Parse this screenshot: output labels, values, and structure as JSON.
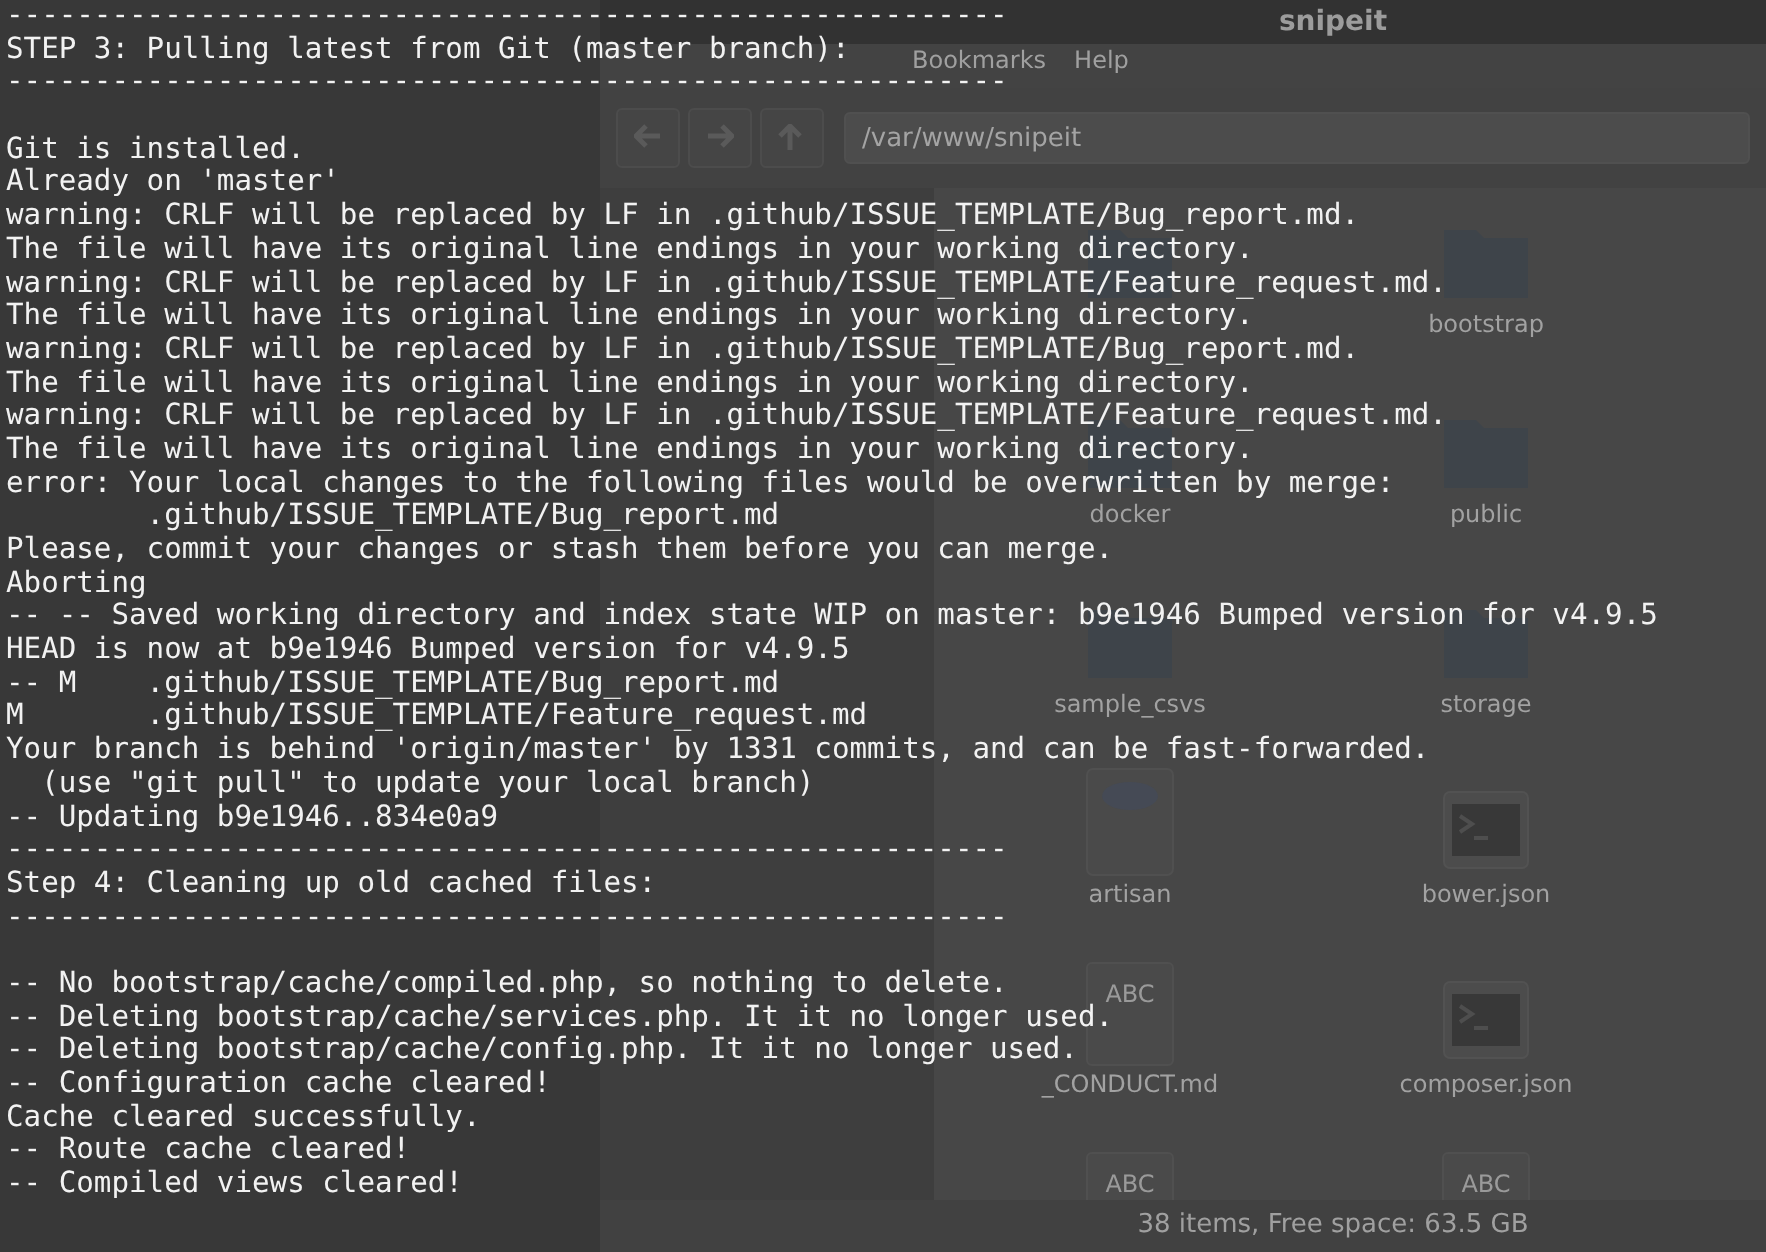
{
  "file_manager": {
    "title": "snipeit",
    "menu": [
      "Bookmarks",
      "Help"
    ],
    "path": "/var/www/snipeit",
    "files": [
      {
        "kind": "folder"
      },
      {
        "kind": "folder",
        "label": "bootstrap"
      },
      {
        "kind": "folder",
        "label": "docker"
      },
      {
        "kind": "folder",
        "label": "public"
      },
      {
        "kind": "folder",
        "label": "sample_csvs"
      },
      {
        "kind": "folder",
        "label": "storage"
      },
      {
        "kind": "code",
        "label": "artisan"
      },
      {
        "kind": "script",
        "label": "bower.json"
      },
      {
        "kind": "text",
        "glyph": "ABC",
        "label": "_CONDUCT.md"
      },
      {
        "kind": "script",
        "label": "composer.json"
      },
      {
        "kind": "text",
        "glyph": "ABC"
      },
      {
        "kind": "text",
        "glyph": "ABC"
      }
    ],
    "status": "38 items, Free space: 63.5 GB"
  },
  "terminal": {
    "lines": [
      {
        "kind": "text",
        "text": "---------------------------------------------------------"
      },
      {
        "kind": "text",
        "text": "STEP 3: Pulling latest from Git (master branch):"
      },
      {
        "kind": "text",
        "text": "---------------------------------------------------------"
      },
      {
        "kind": "blank"
      },
      {
        "kind": "text",
        "text": "Git is installed."
      },
      {
        "kind": "text",
        "text": "Already on 'master'"
      },
      {
        "kind": "text",
        "text": "warning: CRLF will be replaced by LF in .github/ISSUE_TEMPLATE/Bug_report.md."
      },
      {
        "kind": "text",
        "text": "The file will have its original line endings in your working directory."
      },
      {
        "kind": "text",
        "text": "warning: CRLF will be replaced by LF in .github/ISSUE_TEMPLATE/Feature_request.md."
      },
      {
        "kind": "text",
        "text": "The file will have its original line endings in your working directory."
      },
      {
        "kind": "text",
        "text": "warning: CRLF will be replaced by LF in .github/ISSUE_TEMPLATE/Bug_report.md."
      },
      {
        "kind": "text",
        "text": "The file will have its original line endings in your working directory."
      },
      {
        "kind": "text",
        "text": "warning: CRLF will be replaced by LF in .github/ISSUE_TEMPLATE/Feature_request.md."
      },
      {
        "kind": "text",
        "text": "The file will have its original line endings in your working directory."
      },
      {
        "kind": "text",
        "text": "error: Your local changes to the following files would be overwritten by merge:"
      },
      {
        "kind": "text",
        "text": "        .github/ISSUE_TEMPLATE/Bug_report.md"
      },
      {
        "kind": "text",
        "text": "Please, commit your changes or stash them before you can merge."
      },
      {
        "kind": "text",
        "text": "Aborting"
      },
      {
        "kind": "text",
        "text": "-- -- Saved working directory and index state WIP on master: b9e1946 Bumped version for v4.9.5"
      },
      {
        "kind": "text",
        "text": "HEAD is now at b9e1946 Bumped version for v4.9.5"
      },
      {
        "kind": "text",
        "text": "-- M    .github/ISSUE_TEMPLATE/Bug_report.md"
      },
      {
        "kind": "text",
        "text": "M       .github/ISSUE_TEMPLATE/Feature_request.md"
      },
      {
        "kind": "text",
        "text": "Your branch is behind 'origin/master' by 1331 commits, and can be fast-forwarded."
      },
      {
        "kind": "text",
        "text": "  (use \"git pull\" to update your local branch)"
      },
      {
        "kind": "text",
        "text": "-- Updating b9e1946..834e0a9"
      },
      {
        "kind": "text",
        "text": "---------------------------------------------------------"
      },
      {
        "kind": "text",
        "text": "Step 4: Cleaning up old cached files:"
      },
      {
        "kind": "text",
        "text": "---------------------------------------------------------"
      },
      {
        "kind": "blank"
      },
      {
        "kind": "text",
        "text": "-- No bootstrap/cache/compiled.php, so nothing to delete."
      },
      {
        "kind": "text",
        "text": "-- Deleting bootstrap/cache/services.php. It it no longer used."
      },
      {
        "kind": "text",
        "text": "-- Deleting bootstrap/cache/config.php. It it no longer used."
      },
      {
        "kind": "text",
        "text": "-- Configuration cache cleared!"
      },
      {
        "kind": "text",
        "text": "Cache cleared successfully."
      },
      {
        "kind": "text",
        "text": "-- Route cache cleared!"
      },
      {
        "kind": "text",
        "text": "-- Compiled views cleared!"
      }
    ]
  }
}
